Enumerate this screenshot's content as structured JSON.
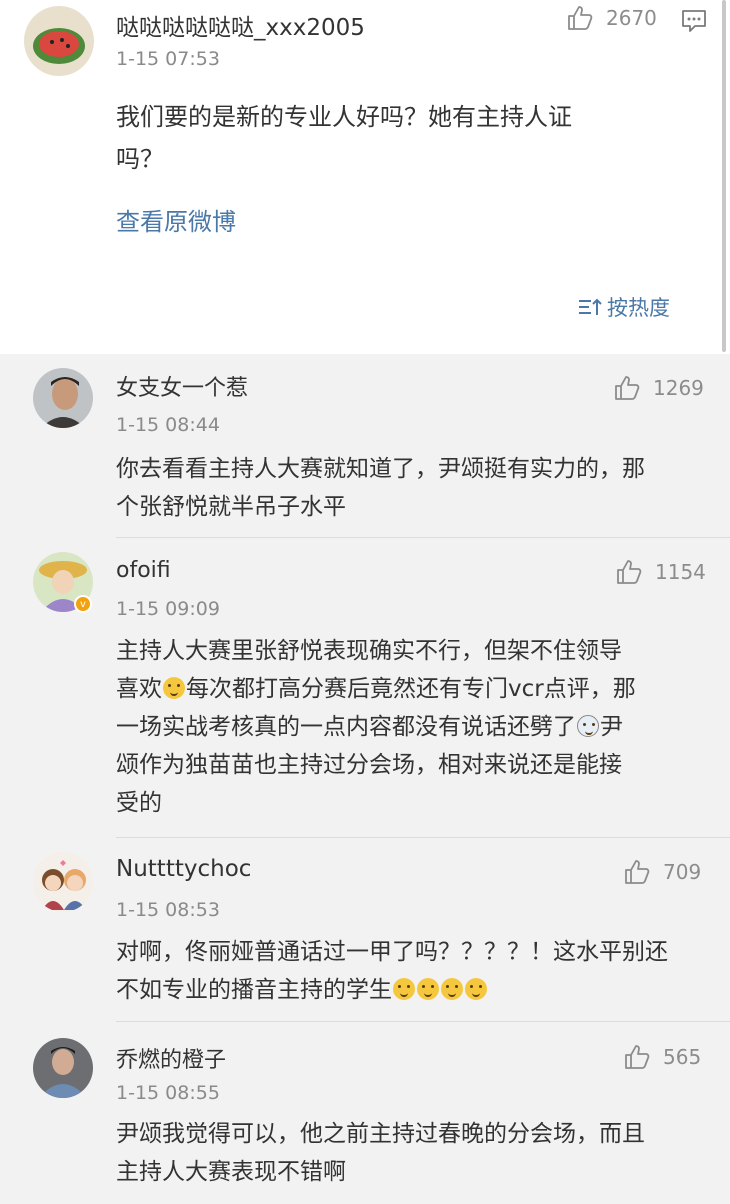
{
  "main_post": {
    "username": "哒哒哒哒哒哒_xxx2005",
    "time": "1-15 07:53",
    "likes": "2670",
    "text_line1": "我们要的是新的专业人好吗？她有主持人证",
    "text_line2": "吗？",
    "view_original": "查看原微博",
    "sort_label": "按热度"
  },
  "replies": [
    {
      "username": "女支女一个惹",
      "time": "1-15 08:44",
      "likes": "1269",
      "lines": [
        "你去看看主持人大赛就知道了，尹颂挺有实力的，那",
        "个张舒悦就半吊子水平"
      ]
    },
    {
      "username": "ofoifi",
      "time": "1-15 09:09",
      "likes": "1154",
      "lines": [
        "主持人大赛里张舒悦表现确实不行，但架不住领导",
        "喜欢",
        "每次都打高分赛后竟然还有专门vcr点评，那",
        "一场实战考核真的一点内容都没有说话还劈了",
        "尹",
        "颂作为独苗苗也主持过分会场，相对来说还是能接",
        "受的"
      ]
    },
    {
      "username": "Nuttttychoc",
      "time": "1-15 08:53",
      "likes": "709",
      "lines": [
        "对啊，佟丽娅普通话过一甲了吗？？？？！这水平别还",
        "不如专业的播音主持的学生"
      ]
    },
    {
      "username": "乔燃的橙子",
      "time": "1-15 08:55",
      "likes": "565",
      "lines": [
        "尹颂我觉得可以，他之前主持过春晚的分会场，而且",
        "主持人大赛表现不错啊"
      ]
    }
  ],
  "icons": {
    "like": "thumbs-up-icon",
    "comment": "comment-icon",
    "sort": "sort-icon",
    "emoji": "emoji-icon"
  },
  "colors": {
    "link": "#4a78a8",
    "reply_bg": "#f2f2f2",
    "meta": "#8a8a8a"
  }
}
